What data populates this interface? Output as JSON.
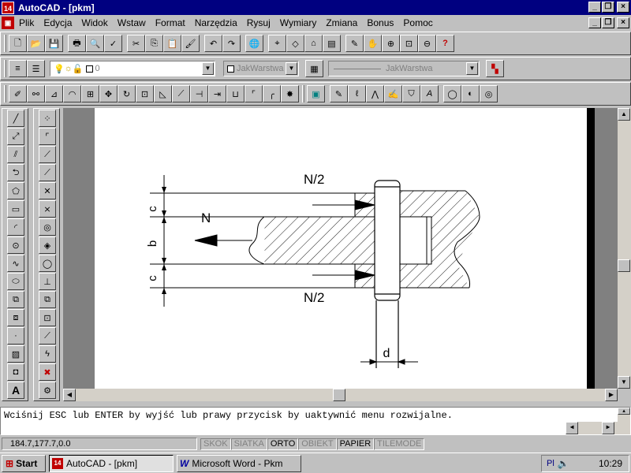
{
  "window": {
    "title": "AutoCAD - [pkm]",
    "app_icon": "14"
  },
  "menu": [
    "Plik",
    "Edycja",
    "Widok",
    "Wstaw",
    "Format",
    "Narzędzia",
    "Rysuj",
    "Wymiary",
    "Zmiana",
    "Bonus",
    "Pomoc"
  ],
  "layer_toolbar": {
    "layer_value": "0",
    "color_value": "JakWarstwa",
    "linetype_value": "JakWarstwa"
  },
  "drawing": {
    "label_top": "N/2",
    "label_bottom": "N/2",
    "label_force": "N",
    "label_c_top": "c",
    "label_b": "b",
    "label_c_bottom": "c",
    "label_d": "d"
  },
  "command_line": "Wciśnij ESC lub ENTER by wyjść lub prawy przycisk by uaktywnić menu rozwijalne.",
  "status": {
    "coords": "184.7,177.7,0.0",
    "modes": [
      {
        "label": "SKOK",
        "on": false
      },
      {
        "label": "SIATKA",
        "on": false
      },
      {
        "label": "ORTO",
        "on": true
      },
      {
        "label": "OBIEKT",
        "on": false
      },
      {
        "label": "PAPIER",
        "on": true
      },
      {
        "label": "TILEMODE",
        "on": false
      }
    ]
  },
  "taskbar": {
    "start": "Start",
    "tasks": [
      "AutoCAD - [pkm]",
      "Microsoft Word - Pkm"
    ],
    "tray_lang": "Pl",
    "clock": "10:29"
  }
}
